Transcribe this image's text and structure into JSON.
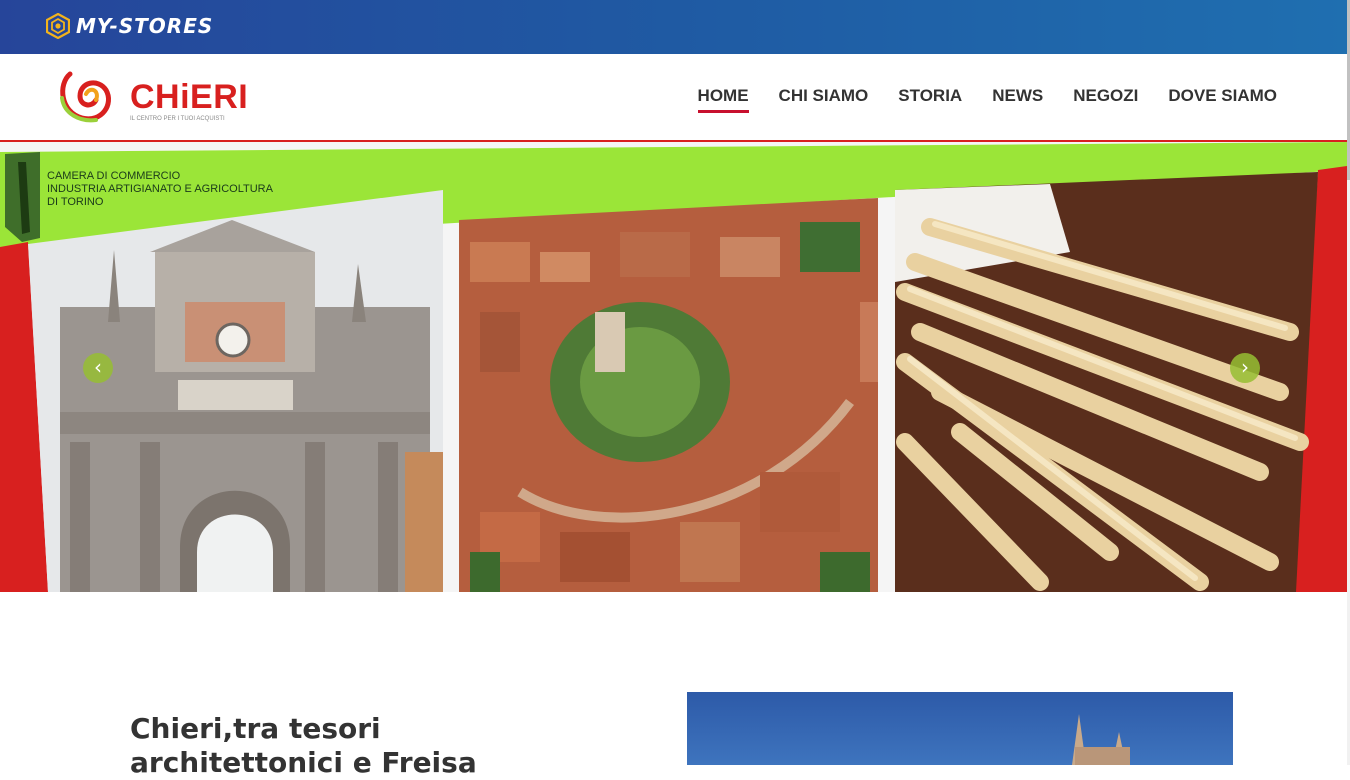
{
  "topbar": {
    "brand": "MY-STORES",
    "brand_icon": "hexagon-logo-icon",
    "colors": {
      "gradient_start": "#26459a",
      "gradient_end": "#1f6fb0"
    }
  },
  "header": {
    "logo": {
      "name": "CHiERI",
      "tagline": "IL CENTRO PER I TUOI ACQUISTI",
      "color": "#d8201f"
    },
    "nav": [
      {
        "label": "HOME",
        "active": true
      },
      {
        "label": "CHI SIAMO",
        "active": false
      },
      {
        "label": "STORIA",
        "active": false
      },
      {
        "label": "NEWS",
        "active": false
      },
      {
        "label": "NEGOZI",
        "active": false
      },
      {
        "label": "DOVE SIAMO",
        "active": false
      }
    ]
  },
  "hero": {
    "sponsor_lines": [
      "CAMERA DI COMMERCIO",
      "INDUSTRIA ARTIGIANATO E AGRICOLTURA",
      "DI TORINO"
    ],
    "slides": [
      "arch-photo",
      "aerial-town-photo",
      "grissini-photo"
    ],
    "prev_icon": "chevron-left-icon",
    "next_icon": "chevron-right-icon",
    "colors": {
      "green": "#9be538",
      "red": "#d8201f"
    }
  },
  "content": {
    "title": "Chieri,tra tesori architettonici e Freisa"
  }
}
